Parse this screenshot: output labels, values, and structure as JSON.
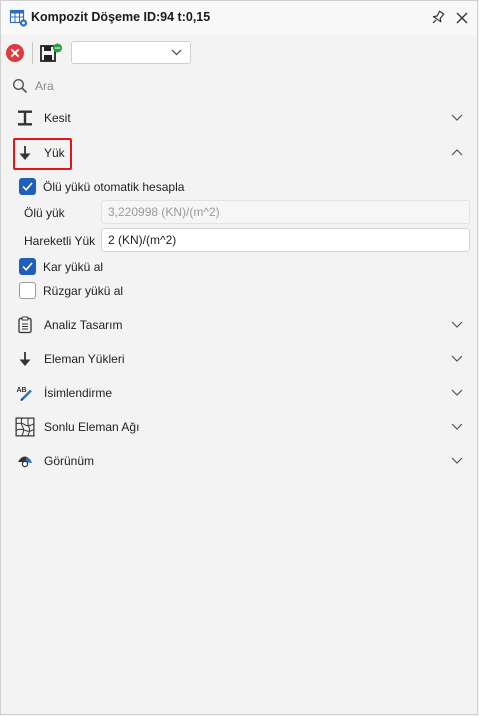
{
  "window": {
    "title": "Kompozit Döşeme ID:94 t:0,15",
    "app_icon": "table-gear-icon"
  },
  "toolbar": {
    "dropdown_value": ""
  },
  "search": {
    "placeholder": "Ara"
  },
  "sections": [
    {
      "label": "Kesit",
      "icon": "i-beam-icon",
      "expanded": false
    },
    {
      "label": "Yük",
      "icon": "arrow-down-icon",
      "expanded": true
    },
    {
      "label": "Analiz Tasarım",
      "icon": "clipboard-icon",
      "expanded": false
    },
    {
      "label": "Eleman Yükleri",
      "icon": "arrow-down-icon",
      "expanded": false
    },
    {
      "label": "İsimlendirme",
      "icon": "text-pen-icon",
      "expanded": false
    },
    {
      "label": "Sonlu Eleman Ağı",
      "icon": "mesh-icon",
      "expanded": false
    },
    {
      "label": "Görünüm",
      "icon": "eye-icon",
      "expanded": false
    }
  ],
  "yuk": {
    "auto_dead_load": {
      "label": "Ölü yükü otomatik hesapla",
      "checked": true
    },
    "dead_load": {
      "label": "Ölü yük",
      "value": "3,220998 (KN)/(m^2)",
      "enabled": false
    },
    "live_load": {
      "label": "Hareketli Yük",
      "value": "2 (KN)/(m^2)",
      "enabled": true
    },
    "snow_load": {
      "label": "Kar yükü al",
      "checked": true
    },
    "wind_load": {
      "label": "Rüzgar yükü al",
      "checked": false
    }
  },
  "colors": {
    "accent": "#1f5fb8",
    "highlight": "#e01818",
    "cancel": "#e0393e"
  }
}
